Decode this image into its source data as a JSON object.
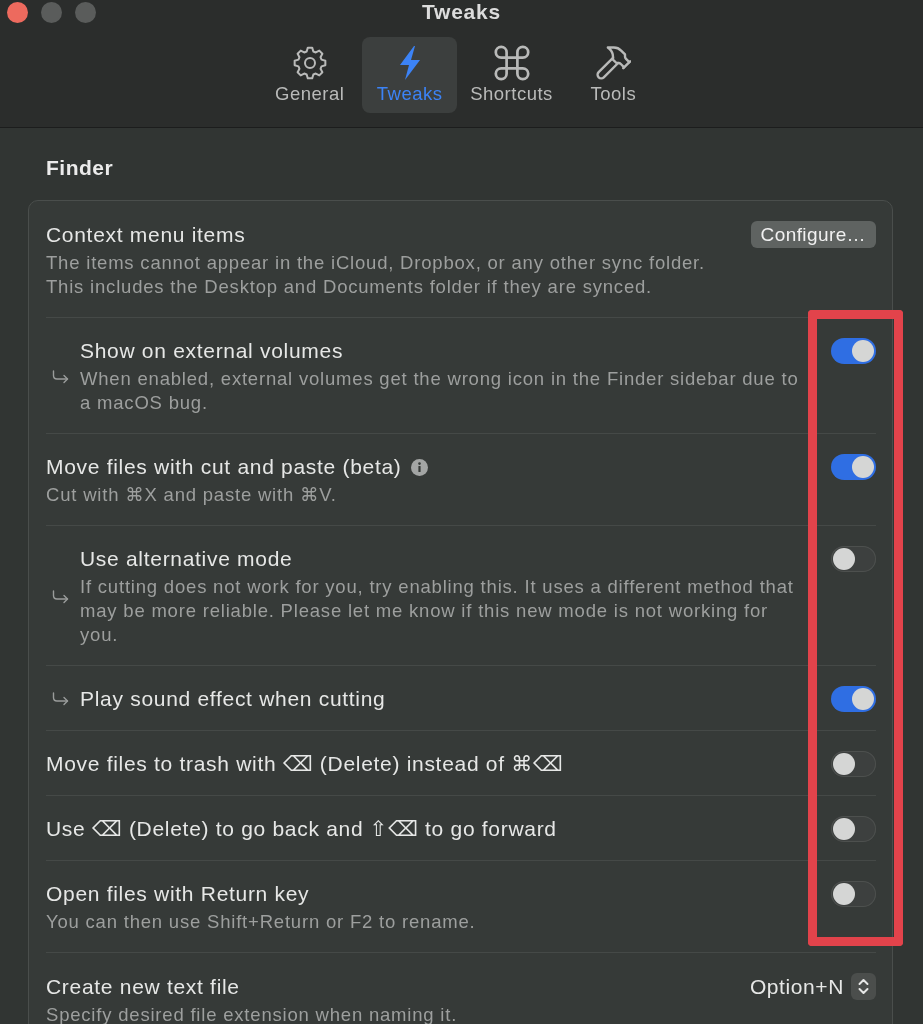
{
  "window": {
    "title": "Tweaks"
  },
  "tabs": [
    {
      "label": "General",
      "selected": false
    },
    {
      "label": "Tweaks",
      "selected": true
    },
    {
      "label": "Shortcuts",
      "selected": false
    },
    {
      "label": "Tools",
      "selected": false
    }
  ],
  "section": {
    "title": "Finder",
    "rows": [
      {
        "kind": "button",
        "title": "Context menu items",
        "description": "The items cannot appear in the iCloud, Dropbox, or any other sync folder.\nThis includes the Desktop and Documents folder if they are synced.",
        "button": "Configure…",
        "indented": false,
        "info": false,
        "highlighted": false
      },
      {
        "kind": "toggle",
        "title": "Show on external volumes",
        "description": "When enabled, external volumes get the wrong icon in the Finder sidebar due to a macOS bug.",
        "on": true,
        "indented": true,
        "info": false,
        "highlighted": true
      },
      {
        "kind": "toggle",
        "title": "Move files with cut and paste (beta)",
        "description": "Cut with ⌘X and paste with ⌘V.",
        "on": true,
        "indented": false,
        "info": true,
        "highlighted": true
      },
      {
        "kind": "toggle",
        "title": "Use alternative mode",
        "description": "If cutting does not work for you, try enabling this. It uses a different method that may be more reliable. Please let me know if this new mode is not working for you.",
        "on": false,
        "indented": true,
        "info": false,
        "highlighted": true
      },
      {
        "kind": "toggle",
        "title": "Play sound effect when cutting",
        "on": true,
        "indented": true,
        "info": false,
        "highlighted": true
      },
      {
        "kind": "toggle",
        "title": "Move files to trash with ⌫ (Delete) instead of ⌘⌫",
        "on": false,
        "indented": false,
        "info": false,
        "highlighted": true
      },
      {
        "kind": "toggle",
        "title": "Use ⌫ (Delete) to go back and ⇧⌫ to go forward",
        "on": false,
        "indented": false,
        "info": false,
        "highlighted": true
      },
      {
        "kind": "toggle",
        "title": "Open files with Return key",
        "description": "You can then use Shift+Return or F2 to rename.",
        "on": false,
        "indented": false,
        "info": false,
        "highlighted": true
      },
      {
        "kind": "popup",
        "title": "Create new text file",
        "description": "Specify desired file extension when naming it.",
        "value": "Option+N",
        "indented": false,
        "info": false,
        "highlighted": false
      }
    ]
  }
}
